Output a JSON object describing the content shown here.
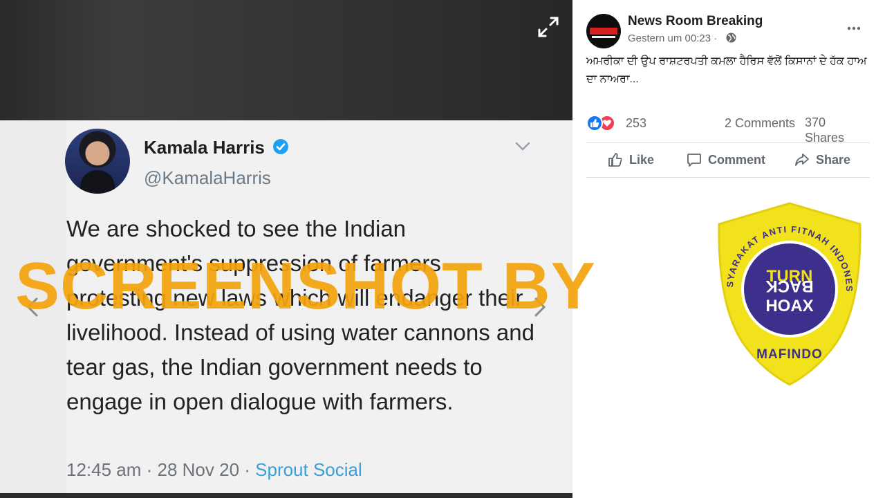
{
  "viewer": {
    "expand_icon": "expand-arrows-icon",
    "prev_icon": "chevron-left-icon",
    "next_icon": "chevron-right-icon"
  },
  "tweet": {
    "author_name": "Kamala Harris",
    "handle": "@KamalaHarris",
    "text": "We are shocked to see the Indian government's suppression of farmers protesting new laws which will endanger their livelihood. Instead of using water cannons and tear gas, the Indian government needs to engage in open dialogue with farmers.",
    "timestamp": "12:45 am · 28 Nov 20 · ",
    "source": "Sprout Social"
  },
  "watermark": {
    "text": "SCREENSHOT BY",
    "color": "#f4a30c"
  },
  "post": {
    "page_name": "News Room Breaking",
    "time": "Gestern um 00:23 · ",
    "text": "ਅਮਰੀਕਾ ਦੀ ਉਪ ਰਾਸ਼ਟਰਪਤੀ ਕਮਲਾ ਹੈਰਿਸ ਵੱਲੋਂ ਕਿਸਾਨਾਂ ਦੇ ਹੱਕ ਹਾਅ ਦਾ ਨਾਅਰਾ...",
    "reaction_count": "253",
    "comments": "2 Comments",
    "shares": "370 Shares",
    "actions": {
      "like": "Like",
      "comment": "Comment",
      "share": "Share"
    }
  },
  "badge": {
    "arc_text": "MASYARAKAT ANTI FITNAH INDONESIA",
    "center_line1": "TURN",
    "center_line2": "BACK",
    "center_line3": "HOAX",
    "bottom_text": "MAFINDO",
    "colors": {
      "shield": "#f2e21b",
      "circle": "#3d2f8c"
    }
  },
  "colors": {
    "facebook_blue": "#1877f2",
    "love_red": "#f33e58",
    "link_blue": "#3a9fd8"
  }
}
